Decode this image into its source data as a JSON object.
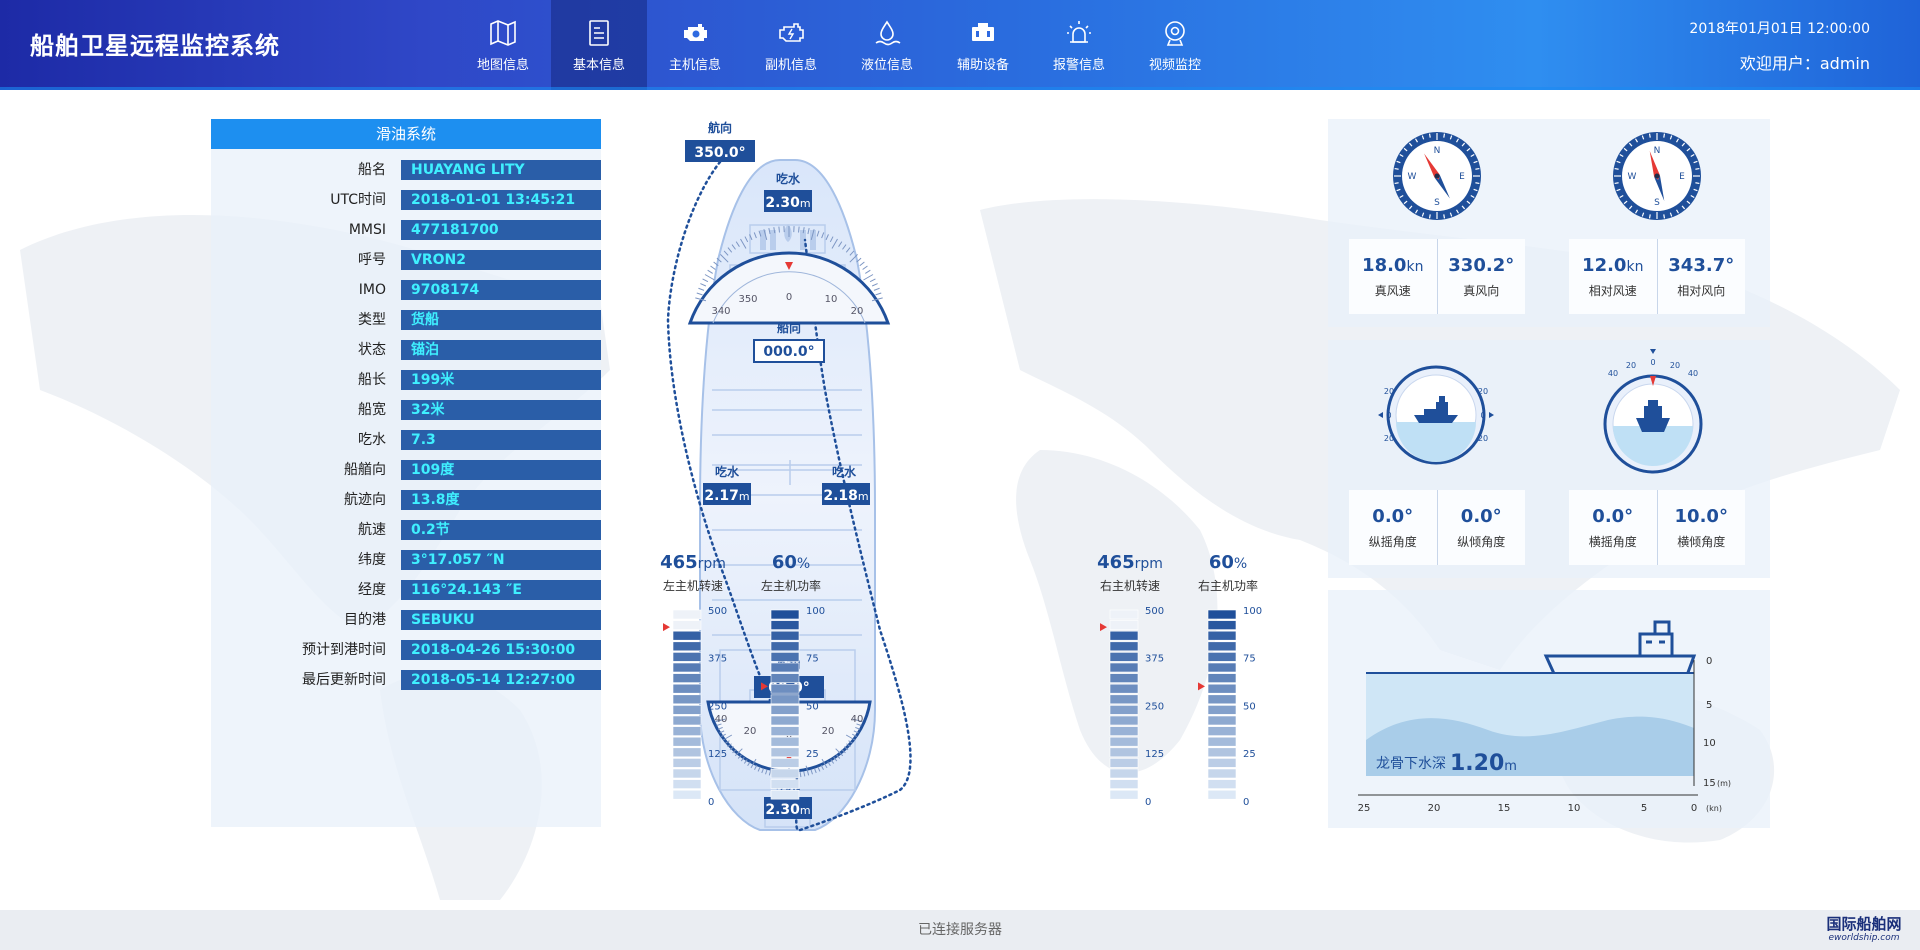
{
  "header": {
    "title": "船舶卫星远程监控系统",
    "datetime": "2018年01月01日   12:00:00",
    "welcome": "欢迎用户：admin",
    "nav": [
      {
        "label": "地图信息",
        "icon": "map-icon"
      },
      {
        "label": "基本信息",
        "icon": "document-icon",
        "active": true
      },
      {
        "label": "主机信息",
        "icon": "engine-icon"
      },
      {
        "label": "副机信息",
        "icon": "generator-icon"
      },
      {
        "label": "液位信息",
        "icon": "liquid-level-icon"
      },
      {
        "label": "辅助设备",
        "icon": "auxiliary-equipment-icon"
      },
      {
        "label": "报警信息",
        "icon": "alarm-icon"
      },
      {
        "label": "视频监控",
        "icon": "camera-icon"
      }
    ]
  },
  "info_panel": {
    "title": "滑油系统",
    "rows": [
      {
        "key": "船名",
        "value": "HUAYANG LITY"
      },
      {
        "key": "UTC时间",
        "value": "2018-01-01   13:45:21"
      },
      {
        "key": "MMSI",
        "value": "477181700"
      },
      {
        "key": "呼号",
        "value": "VRON2"
      },
      {
        "key": "IMO",
        "value": "9708174"
      },
      {
        "key": "类型",
        "value": "货船"
      },
      {
        "key": "状态",
        "value": "锚泊"
      },
      {
        "key": "船长",
        "value": "199米"
      },
      {
        "key": "船宽",
        "value": "32米"
      },
      {
        "key": "吃水",
        "value": "7.3"
      },
      {
        "key": "船艏向",
        "value": "109度"
      },
      {
        "key": "航迹向",
        "value": "13.8度"
      },
      {
        "key": "航速",
        "value": "0.2节"
      },
      {
        "key": "纬度",
        "value": "3°17.057 ″N"
      },
      {
        "key": "经度",
        "value": "116°24.143 ″E"
      },
      {
        "key": "目的港",
        "value": "SEBUKU"
      },
      {
        "key": "预计到港时间",
        "value": "2018-04-26   15:30:00"
      },
      {
        "key": "最后更新时间",
        "value": "2018-05-14   12:27:00"
      }
    ]
  },
  "ship": {
    "course_label": "航向",
    "course_value": "350.0°",
    "draft_label": "吃水",
    "draft_bow": "2.30",
    "draft_port": "2.17",
    "draft_starboard": "2.18",
    "draft_stern": "2.30",
    "draft_unit": "m",
    "heading_label": "船向",
    "heading_value": "000.0°",
    "heading_scale": [
      "340",
      "350",
      "0",
      "10",
      "20"
    ],
    "rudder_label": "舵角",
    "rudder_value": "00.0°",
    "rudder_scale": [
      "40",
      "20",
      "0",
      "20",
      "40"
    ]
  },
  "gauges": [
    {
      "value": "465",
      "unit": "rpm",
      "label": "左主机转速",
      "ticks": [
        "500",
        "375",
        "250",
        "125",
        "0"
      ],
      "max": 500,
      "level": 465,
      "pointer_fraction": 0.91
    },
    {
      "value": "60",
      "unit": "%",
      "label": "左主机功率",
      "ticks": [
        "100",
        "75",
        "50",
        "25",
        "0"
      ],
      "max": 100,
      "level": 100,
      "pointer_fraction": 0.6
    },
    {
      "value": "465",
      "unit": "rpm",
      "label": "右主机转速",
      "ticks": [
        "500",
        "375",
        "250",
        "125",
        "0"
      ],
      "max": 500,
      "level": 465,
      "pointer_fraction": 0.91
    },
    {
      "value": "60",
      "unit": "%",
      "label": "右主机功率",
      "ticks": [
        "100",
        "75",
        "50",
        "25",
        "0"
      ],
      "max": 100,
      "level": 100,
      "pointer_fraction": 0.6
    }
  ],
  "wind": {
    "compass_letters": [
      "N",
      "E",
      "S",
      "W"
    ],
    "true": {
      "speed": "18.0",
      "speed_unit": "kn",
      "speed_label": "真风速",
      "dir": "330.2°",
      "dir_label": "真风向",
      "needle_deg": 330.2
    },
    "relative": {
      "speed": "12.0",
      "speed_unit": "kn",
      "speed_label": "相对风速",
      "dir": "343.7°",
      "dir_label": "相对风向",
      "needle_deg": 343.7
    }
  },
  "attitude": {
    "pitch_scale": [
      "20",
      "0",
      "20"
    ],
    "roll_scale": [
      "40",
      "20",
      "0",
      "20",
      "40"
    ],
    "pitch_angle": {
      "value": "0.0°",
      "label": "纵摇角度"
    },
    "pitch_inclination": {
      "value": "0.0°",
      "label": "纵倾角度"
    },
    "roll_angle": {
      "value": "0.0°",
      "label": "横摇角度"
    },
    "roll_inclination": {
      "value": "10.0°",
      "label": "横倾角度"
    }
  },
  "depth": {
    "label": "龙骨下水深",
    "value": "1.20",
    "unit": "m",
    "y_ticks": [
      "0",
      "5",
      "10",
      "15"
    ],
    "y_unit": "(m)",
    "x_ticks": [
      "25",
      "20",
      "15",
      "10",
      "5",
      "0"
    ],
    "x_unit": "(kn)"
  },
  "footer": {
    "status": "已连接服务器",
    "watermark_cn": "国际船舶网",
    "watermark_en": "eworldship.com"
  },
  "colors": {
    "accent": "#1d8ff0",
    "value_bg": "#2a5ea8",
    "value_text": "#3ff0ff",
    "deep_blue": "#1f4f9a",
    "alert": "#e53935"
  }
}
